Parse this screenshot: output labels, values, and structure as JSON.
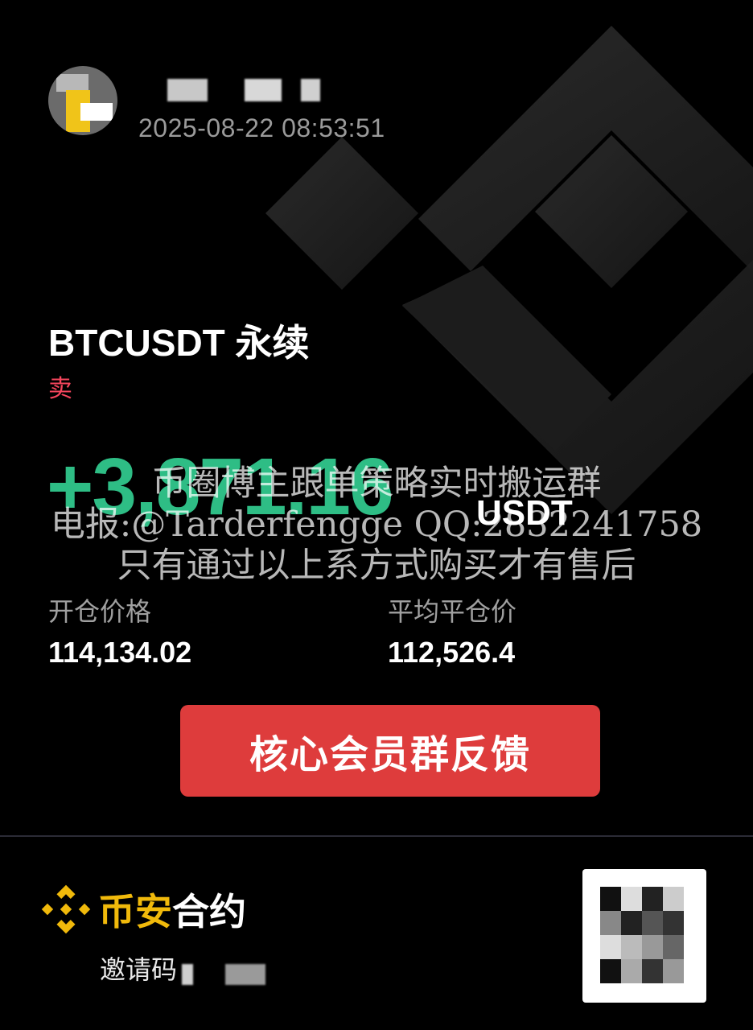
{
  "header": {
    "timestamp": "2025-08-22 08:53:51"
  },
  "position": {
    "symbol": "BTCUSDT 永续",
    "side": "卖"
  },
  "pnl": {
    "value": "+3,871.16",
    "unit": "USDT"
  },
  "watermark": {
    "line1": "币圈博主跟单策略实时搬运群",
    "line2": "电报:@Tarderfengge QQ:2832241758",
    "line3": "只有通过以上系方式购买才有售后"
  },
  "stats": {
    "entry_label": "开仓价格",
    "entry_value": "114,134.02",
    "close_label": "平均平仓价",
    "close_value": "112,526.4"
  },
  "cta": {
    "label": "核心会员群反馈"
  },
  "footer": {
    "brand_part1": "币安",
    "brand_part2": "合约",
    "invite_label": "邀请码"
  },
  "colors": {
    "profit": "#2ebd85",
    "sell": "#f6465d",
    "cta_bg": "#de3c3c",
    "brand_yellow": "#f0b90b",
    "background": "#000000"
  }
}
